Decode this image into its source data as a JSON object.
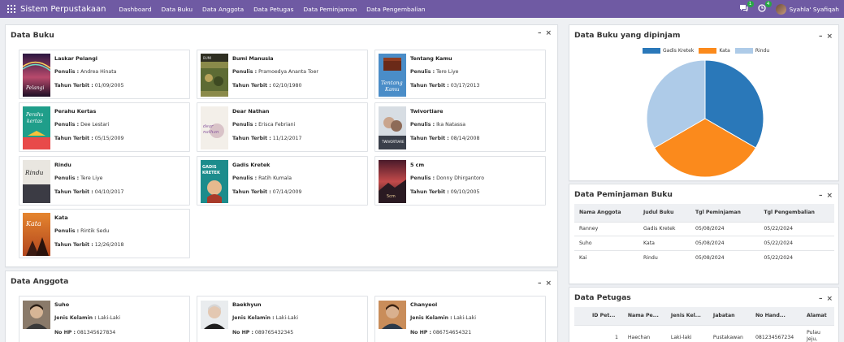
{
  "navbar": {
    "brand": "Sistem Perpustakaan",
    "menu": [
      "Dashboard",
      "Data Buku",
      "Data Anggota",
      "Data Petugas",
      "Data Peminjaman",
      "Data Pengembalian"
    ],
    "chat_count": "1",
    "activity_count": "4",
    "user": "Syahla' Syafiqah"
  },
  "panels": {
    "books_title": "Data Buku",
    "members_title": "Data Anggota",
    "pie_title": "Data Buku yang dipinjam",
    "loans_title": "Data Peminjaman Buku",
    "staff_title": "Data Petugas"
  },
  "labels": {
    "penulis": "Penulis :",
    "tahun": "Tahun Terbit :",
    "gender": "Jenis Kelamin :",
    "hp": "No HP :"
  },
  "books": [
    {
      "title": "Laskar Pelangi",
      "author": "Andrea Hinata",
      "year": "01/09/2005"
    },
    {
      "title": "Bumi Manusia",
      "author": "Pramoedya Ananta Toer",
      "year": "02/10/1980"
    },
    {
      "title": "Tentang Kamu",
      "author": "Tere Liye",
      "year": "03/17/2013"
    },
    {
      "title": "Perahu Kertas",
      "author": "Dee Lestari",
      "year": "05/15/2009"
    },
    {
      "title": "Dear Nathan",
      "author": "Erisca Febriani",
      "year": "11/12/2017"
    },
    {
      "title": "Twivortiare",
      "author": "Ika Natassa",
      "year": "08/14/2008"
    },
    {
      "title": "Rindu",
      "author": "Tere Liye",
      "year": "04/10/2017"
    },
    {
      "title": "Gadis Kretek",
      "author": "Ratih Kumala",
      "year": "07/14/2009"
    },
    {
      "title": "5 cm",
      "author": "Donny Dhirgantoro",
      "year": "09/10/2005"
    },
    {
      "title": "Kata",
      "author": "Rintik Sedu",
      "year": "12/26/2018"
    }
  ],
  "members": [
    {
      "name": "Suho",
      "gender": "Laki-Laki",
      "phone": "081345627834"
    },
    {
      "name": "Baekhyun",
      "gender": "Laki-Laki",
      "phone": "089765432345"
    },
    {
      "name": "Chanyeol",
      "gender": "Laki-Laki",
      "phone": "086754654321"
    }
  ],
  "loans": {
    "headers": [
      "Nama Anggota",
      "Judul Buku",
      "Tgl Peminjaman",
      "Tgl Pengembalian"
    ],
    "rows": [
      [
        "Ranney",
        "Gadis Kretek",
        "05/08/2024",
        "05/22/2024"
      ],
      [
        "Suho",
        "Kata",
        "05/08/2024",
        "05/22/2024"
      ],
      [
        "Kai",
        "Rindu",
        "05/08/2024",
        "05/22/2024"
      ]
    ]
  },
  "staff": {
    "headers": [
      "ID Pet...",
      "Nama Pe...",
      "Jenis Kel...",
      "Jabatan",
      "No Hand...",
      "Alamat"
    ],
    "rows": [
      [
        "1",
        "Haechan",
        "Laki-laki",
        "Pustakawan",
        "081234567234",
        "Pulau Jeju, Korea"
      ]
    ]
  },
  "chart_data": {
    "type": "pie",
    "title": "",
    "categories": [
      "Gadis Kretek",
      "Kata",
      "Rindu"
    ],
    "values": [
      1,
      1,
      1
    ],
    "colors": [
      "#2a78b9",
      "#fb8a1c",
      "#aecbe8"
    ],
    "legend": "top"
  },
  "icons": {
    "apps": "apps-grid-icon",
    "chat": "chat-icon",
    "activity": "clock-icon",
    "minimize": "minimize-icon",
    "close": "close-icon"
  }
}
